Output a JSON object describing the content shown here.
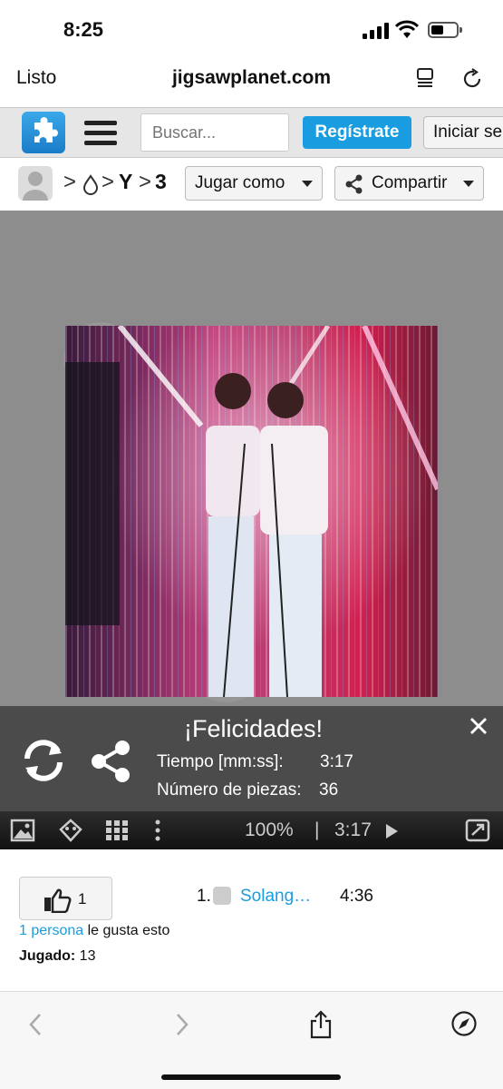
{
  "status": {
    "time": "8:25"
  },
  "browser": {
    "done": "Listo",
    "url": "jigsawplanet.com"
  },
  "toolbar": {
    "search_placeholder": "Buscar...",
    "register": "Regístrate",
    "login": "Iniciar se"
  },
  "breadcrumb": {
    "item_1": "Y",
    "item_2": "3",
    "play_as": "Jugar como",
    "share": "Compartir"
  },
  "congrats": {
    "title": "¡Felicidades!",
    "time_label": "Tiempo [mm:ss]:",
    "time_value": "3:17",
    "pieces_label": "Número de piezas:",
    "pieces_value": "36"
  },
  "player": {
    "zoom": "100%",
    "separator": "|",
    "timer": "3:17"
  },
  "info": {
    "like_count": "1",
    "likes_link": "1 persona",
    "likes_rest": " le gusta esto",
    "played_label": "Jugado:",
    "played_value": " 13",
    "score_rank": "1.",
    "score_name": "Solang…",
    "score_time": "4:36"
  },
  "colors": {
    "accent": "#1a9ce0",
    "player_bg": "#1e1e1e",
    "panel_bg": "#3c3c3c"
  }
}
